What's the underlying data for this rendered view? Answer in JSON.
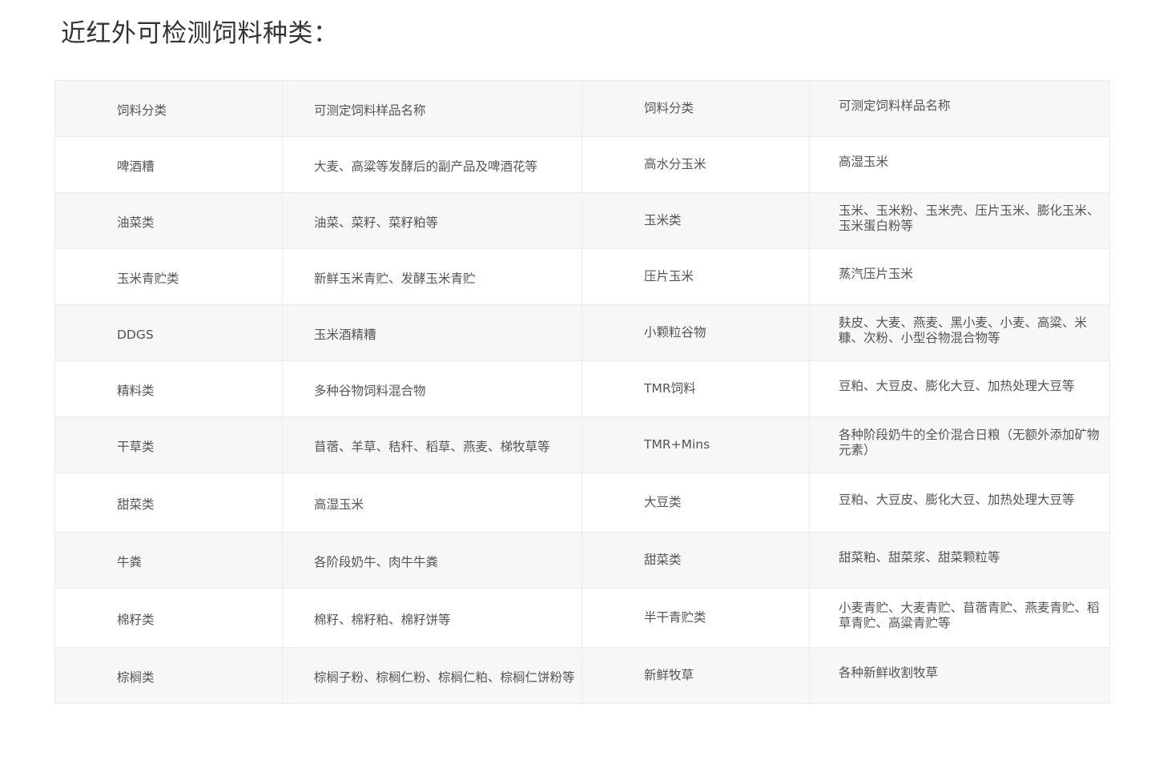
{
  "page": {
    "title": "近红外可检测饲料种类："
  },
  "table": {
    "headers": [
      "饲料分类",
      "可测定饲料样品名称",
      "饲料分类",
      "可测定饲料样品名称"
    ],
    "rows": [
      [
        "啤酒糟",
        "大麦、高粱等发酵后的副产品及啤酒花等",
        "高水分玉米",
        "高湿玉米"
      ],
      [
        "油菜类",
        "油菜、菜籽、菜籽粕等",
        "玉米类",
        "玉米、玉米粉、玉米壳、压片玉米、膨化玉米、玉米蛋白粉等"
      ],
      [
        "玉米青贮类",
        "新鲜玉米青贮、发酵玉米青贮",
        "压片玉米",
        "蒸汽压片玉米"
      ],
      [
        "DDGS",
        "玉米酒精糟",
        "小颗粒谷物",
        "麸皮、大麦、燕麦、黑小麦、小麦、高粱、米糠、次粉、小型谷物混合物等"
      ],
      [
        "精料类",
        "多种谷物饲料混合物",
        "TMR饲料",
        "豆粕、大豆皮、膨化大豆、加热处理大豆等"
      ],
      [
        "干草类",
        "苜蓿、羊草、秸秆、稻草、燕麦、梯牧草等",
        "TMR+Mins",
        "各种阶段奶牛的全价混合日粮（无额外添加矿物元素）"
      ],
      [
        "甜菜类",
        "高湿玉米",
        "大豆类",
        "豆粕、大豆皮、膨化大豆、加热处理大豆等"
      ],
      [
        "牛粪",
        "各阶段奶牛、肉牛牛粪",
        "甜菜类",
        "甜菜粕、甜菜浆、甜菜颗粒等"
      ],
      [
        "棉籽类",
        "棉籽、棉籽粕、棉籽饼等",
        "半干青贮类",
        "小麦青贮、大麦青贮、苜蓿青贮、燕麦青贮、稻草青贮、高粱青贮等"
      ],
      [
        "棕榈类",
        "棕榈子粉、棕榈仁粉、棕榈仁粕、棕榈仁饼粉等",
        "新鲜牧草",
        "各种新鲜收割牧草"
      ]
    ]
  }
}
